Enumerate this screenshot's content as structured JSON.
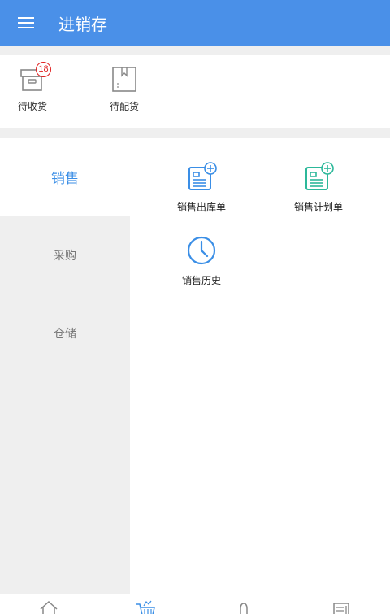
{
  "header": {
    "title": "进销存",
    "menu_icon": "hamburger-menu-icon"
  },
  "quick_actions": [
    {
      "label": "待收货",
      "icon": "inbox-box-icon",
      "badge": "18"
    },
    {
      "label": "待配货",
      "icon": "bookmark-page-icon"
    }
  ],
  "sidebar": {
    "tabs": [
      {
        "label": "销售",
        "active": true
      },
      {
        "label": "采购",
        "active": false
      },
      {
        "label": "仓储",
        "active": false
      }
    ]
  },
  "grid": [
    {
      "label": "销售出库单",
      "icon": "document-add-icon",
      "color": "#3a8ee6"
    },
    {
      "label": "销售计划单",
      "icon": "document-add-icon",
      "color": "#2cb89a"
    },
    {
      "label": "销售历史",
      "icon": "clock-icon",
      "color": "#3a8ee6"
    }
  ],
  "bottom_nav": [
    {
      "icon": "home-icon"
    },
    {
      "icon": "cart-icon"
    },
    {
      "icon": "bulb-icon"
    },
    {
      "icon": "news-icon"
    }
  ],
  "colors": {
    "header_bg": "#4a90e8",
    "accent": "#3a8ee6",
    "teal": "#2cb89a",
    "badge": "#e02020"
  }
}
